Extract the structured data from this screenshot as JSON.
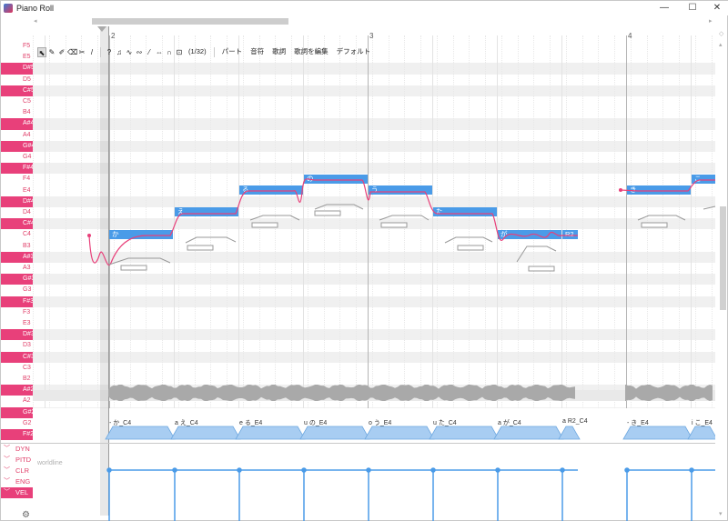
{
  "window": {
    "title": "Piano Roll",
    "controls": {
      "minimize": "—",
      "maximize": "☐",
      "close": "✕"
    }
  },
  "toolbar": {
    "tools": [
      {
        "name": "select-tool-icon",
        "glyph": "⬉"
      },
      {
        "name": "pencil-tool-icon",
        "glyph": "✎"
      },
      {
        "name": "line-pencil-tool-icon",
        "glyph": "✐"
      },
      {
        "name": "eraser-tool-icon",
        "glyph": "⌫"
      },
      {
        "name": "knife-tool-icon",
        "glyph": "✂"
      },
      {
        "name": "brush-tool-icon",
        "glyph": "/"
      }
    ],
    "toggles": [
      {
        "name": "help-icon",
        "glyph": "?"
      },
      {
        "name": "note-icon",
        "glyph": "♫"
      },
      {
        "name": "vibrato-icon",
        "glyph": "∿"
      },
      {
        "name": "pitch-point-icon",
        "glyph": "∾"
      },
      {
        "name": "slur-icon",
        "glyph": "⁄"
      },
      {
        "name": "pan-icon",
        "glyph": "⇔"
      },
      {
        "name": "curve-icon",
        "glyph": "∩"
      },
      {
        "name": "snap-icon",
        "glyph": "⊡"
      }
    ],
    "snap_text": "(1/32)",
    "menus": [
      "パート",
      "音符",
      "歌詞",
      "歌詞を編集",
      "デフォルト"
    ]
  },
  "piano_keys": [
    {
      "label": "F5",
      "black": false
    },
    {
      "label": "E5",
      "black": false
    },
    {
      "label": "D#5",
      "black": true
    },
    {
      "label": "D5",
      "black": false
    },
    {
      "label": "C#5",
      "black": true
    },
    {
      "label": "C5",
      "black": false
    },
    {
      "label": "B4",
      "black": false
    },
    {
      "label": "A#4",
      "black": true
    },
    {
      "label": "A4",
      "black": false
    },
    {
      "label": "G#4",
      "black": true
    },
    {
      "label": "G4",
      "black": false
    },
    {
      "label": "F#4",
      "black": true
    },
    {
      "label": "F4",
      "black": false
    },
    {
      "label": "E4",
      "black": false
    },
    {
      "label": "D#4",
      "black": true
    },
    {
      "label": "D4",
      "black": false
    },
    {
      "label": "C#4",
      "black": true
    },
    {
      "label": "C4",
      "black": false
    },
    {
      "label": "B3",
      "black": false
    },
    {
      "label": "A#3",
      "black": true
    },
    {
      "label": "A3",
      "black": false
    },
    {
      "label": "G#3",
      "black": true
    },
    {
      "label": "G3",
      "black": false
    },
    {
      "label": "F#3",
      "black": true
    },
    {
      "label": "F3",
      "black": false
    },
    {
      "label": "E3",
      "black": false
    },
    {
      "label": "D#3",
      "black": true
    },
    {
      "label": "D3",
      "black": false
    },
    {
      "label": "C#3",
      "black": true
    },
    {
      "label": "C3",
      "black": false
    },
    {
      "label": "B2",
      "black": false
    },
    {
      "label": "A#2",
      "black": true
    },
    {
      "label": "A2",
      "black": false
    },
    {
      "label": "G#2",
      "black": true
    },
    {
      "label": "G2",
      "black": false
    },
    {
      "label": "F#2",
      "black": true
    }
  ],
  "bars": [
    "2",
    "3",
    "4"
  ],
  "notes": [
    {
      "lyric": "か",
      "pitch": "C4"
    },
    {
      "lyric": "え",
      "pitch": "C#4"
    },
    {
      "lyric": "る",
      "pitch": "E4"
    },
    {
      "lyric": "の",
      "pitch": "F4"
    },
    {
      "lyric": "う",
      "pitch": "E4"
    },
    {
      "lyric": "た",
      "pitch": "C#4"
    },
    {
      "lyric": "が",
      "pitch": "C4"
    },
    {
      "lyric": "R2",
      "pitch": "C4"
    },
    {
      "lyric": "き",
      "pitch": "E4"
    },
    {
      "lyric": "こ",
      "pitch": "F4"
    }
  ],
  "phonemes": [
    "- か_C4",
    "a え_C4",
    "e る_E4",
    "u の_E4",
    "o う_E4",
    "u た_C4",
    "a が_C4",
    "a R2_C4",
    "- き_E4",
    "i こ_E4"
  ],
  "expressions": [
    {
      "label": "DYN",
      "active": false
    },
    {
      "label": "PITD",
      "active": false
    },
    {
      "label": "CLR",
      "active": false
    },
    {
      "label": "ENG",
      "active": false
    },
    {
      "label": "VEL",
      "active": true
    }
  ],
  "worldline_label": "worldline",
  "colors": {
    "accent": "#e8407a",
    "note": "#4a9be8",
    "pitch_curve": "#e8407a",
    "phoneme": "#a8cdf2"
  }
}
